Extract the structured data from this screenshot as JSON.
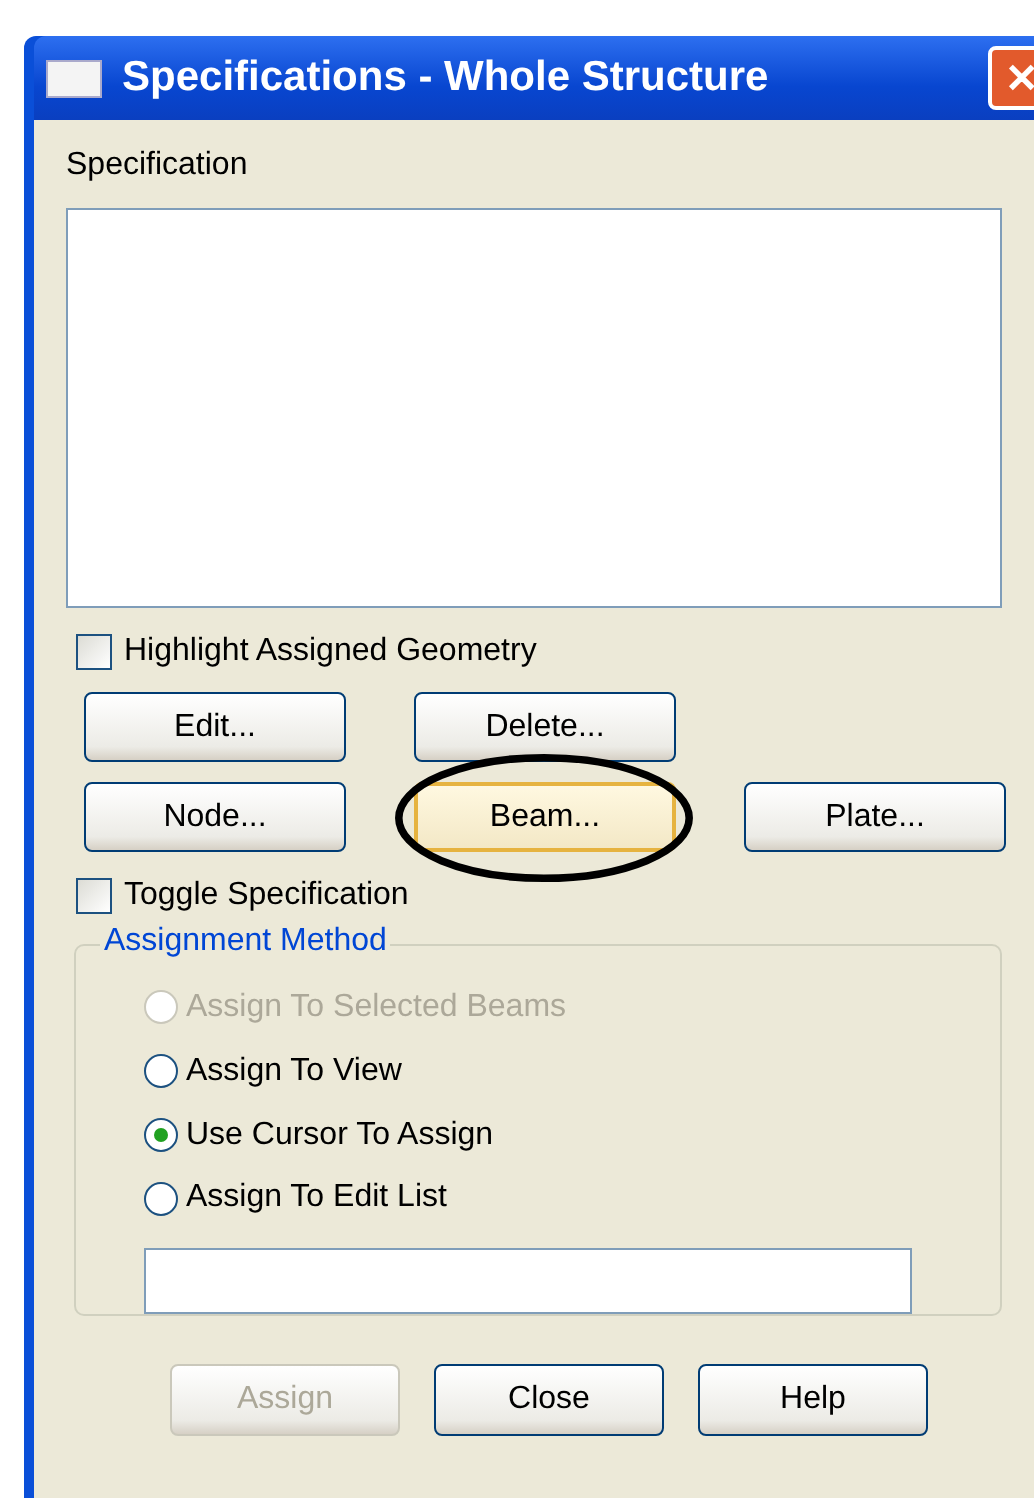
{
  "window": {
    "title": "Specifications - Whole Structure",
    "close_glyph": "✕"
  },
  "specification": {
    "label": "Specification"
  },
  "highlight_checkbox": {
    "label": "Highlight Assigned Geometry",
    "checked": false
  },
  "button_rows": [
    [
      {
        "label": "Edit...",
        "hot": false
      },
      {
        "label": "Delete...",
        "hot": false
      }
    ],
    [
      {
        "label": "Node...",
        "hot": false
      },
      {
        "label": "Beam...",
        "hot": true,
        "circled": true
      },
      {
        "label": "Plate...",
        "hot": false
      }
    ]
  ],
  "toggle_checkbox": {
    "label": "Toggle Specification",
    "checked": false
  },
  "assignment_method": {
    "legend": "Assignment Method",
    "options": [
      {
        "label": "Assign To Selected Beams",
        "selected": false,
        "disabled": true
      },
      {
        "label": "Assign To View",
        "selected": false,
        "disabled": false
      },
      {
        "label": "Use Cursor To Assign",
        "selected": true,
        "disabled": false
      },
      {
        "label": "Assign To Edit List",
        "selected": false,
        "disabled": false
      }
    ]
  },
  "buttons": [
    {
      "label": "Assign",
      "disabled": true
    },
    {
      "label": "Close",
      "disabled": false
    },
    {
      "label": "Help",
      "disabled": false
    }
  ]
}
